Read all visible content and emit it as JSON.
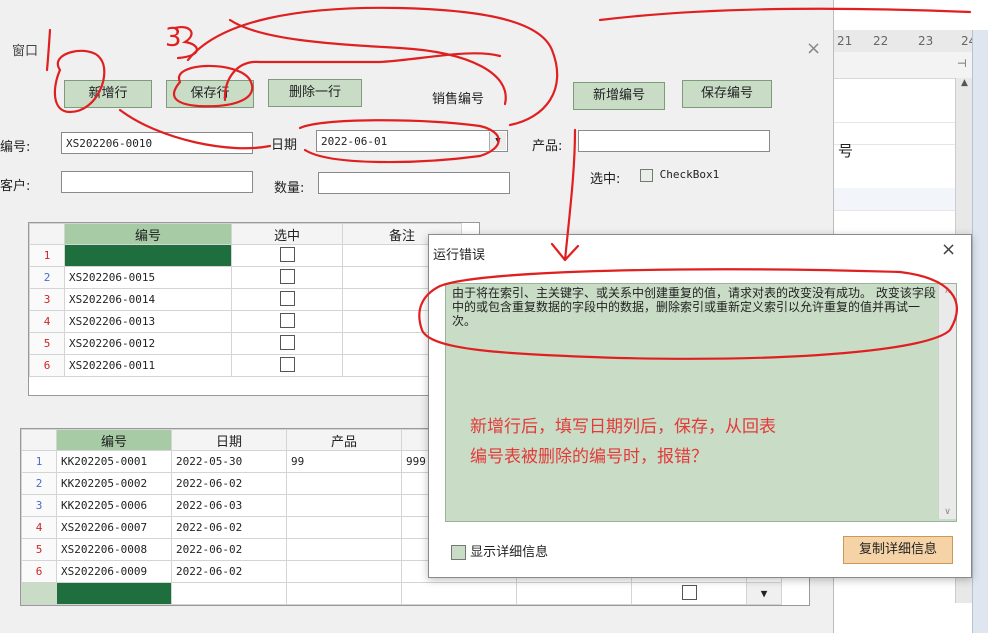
{
  "window": {
    "title": "窗口",
    "close": "×"
  },
  "toolbar": {
    "add_row": "新增行",
    "save_row": "保存行",
    "delete_row": "删除一行",
    "sales_no_label": "销售编号",
    "add_no": "新增编号",
    "save_no": "保存编号"
  },
  "form": {
    "code_label": "编号:",
    "code_value": "XS202206-0010",
    "date_label": "日期",
    "date_value": "2022-06-01",
    "product_label": "产品:",
    "customer_label": "客户:",
    "qty_label": "数量:",
    "selected_label": "选中:",
    "checkbox_text": "CheckBox1"
  },
  "grid1": {
    "headers": [
      "编号",
      "选中",
      "备注"
    ],
    "rows": [
      {
        "n": "1",
        "code": ""
      },
      {
        "n": "2",
        "code": "XS202206-0015"
      },
      {
        "n": "3",
        "code": "XS202206-0014"
      },
      {
        "n": "4",
        "code": "XS202206-0013"
      },
      {
        "n": "5",
        "code": "XS202206-0012"
      },
      {
        "n": "6",
        "code": "XS202206-0011"
      }
    ]
  },
  "grid2": {
    "headers": [
      "编号",
      "日期",
      "产品"
    ],
    "rows": [
      {
        "n": "1",
        "code": "KK202205-0001",
        "date": "2022-05-30",
        "product": "99",
        "extra": "999"
      },
      {
        "n": "2",
        "code": "KK202205-0002",
        "date": "2022-06-02",
        "product": "",
        "extra": ""
      },
      {
        "n": "3",
        "code": "KK202205-0006",
        "date": "2022-06-03",
        "product": "",
        "extra": ""
      },
      {
        "n": "4",
        "code": "XS202206-0007",
        "date": "2022-06-02",
        "product": "",
        "extra": ""
      },
      {
        "n": "5",
        "code": "XS202206-0008",
        "date": "2022-06-02",
        "product": "",
        "extra": ""
      },
      {
        "n": "6",
        "code": "XS202206-0009",
        "date": "2022-06-02",
        "product": "",
        "extra": ""
      }
    ]
  },
  "error_dialog": {
    "title": "运行错误",
    "close": "×",
    "message": "由于将在索引、主关键字、或关系中创建重复的值，请求对表的改变没有成功。 改变该字段中的或包含重复数据的字段中的数据，删除索引或重新定义索引以允许重复的值并再试一次。",
    "note_line1": "新增行后，填写日期列后，保存，从回表",
    "note_line2": "编号表被删除的编号时，报错？",
    "show_details": "显示详细信息",
    "copy_details": "复制详细信息"
  },
  "background_app": {
    "ruler_marks": [
      "21",
      "22",
      "23",
      "24"
    ],
    "side_char": "号"
  },
  "annotations": {
    "mark1": "1",
    "mark3": "3",
    "ink_color": "#e02020"
  }
}
